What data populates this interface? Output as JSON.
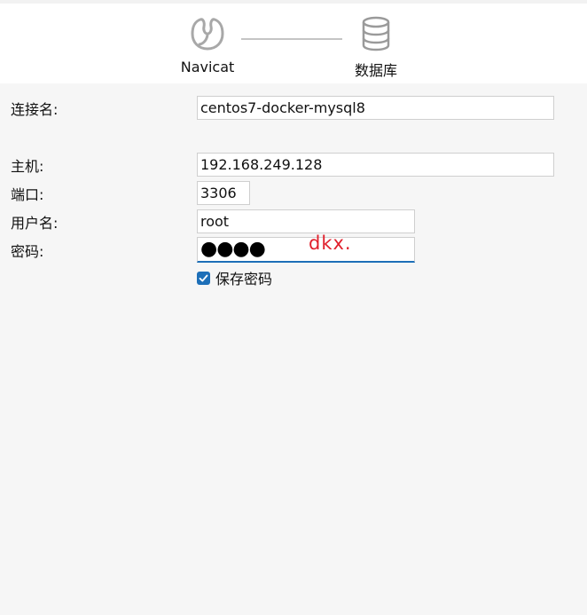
{
  "wizard": {
    "steps": [
      {
        "label": "Navicat",
        "icon": "navicat-logo-icon"
      },
      {
        "label": "数据库",
        "icon": "database-icon"
      }
    ]
  },
  "form": {
    "connection_name": {
      "label": "连接名:",
      "value": "centos7-docker-mysql8"
    },
    "host": {
      "label": "主机:",
      "value": "192.168.249.128"
    },
    "port": {
      "label": "端口:",
      "value": "3306"
    },
    "username": {
      "label": "用户名:",
      "value": "root"
    },
    "password": {
      "label": "密码:",
      "masked_value": "●●●●",
      "annotation": "dkx."
    },
    "save_password": {
      "label": "保存密码",
      "checked": true
    }
  },
  "colors": {
    "accent": "#1d6fb8",
    "annotation": "#e0202c",
    "background": "#f6f6f6"
  }
}
